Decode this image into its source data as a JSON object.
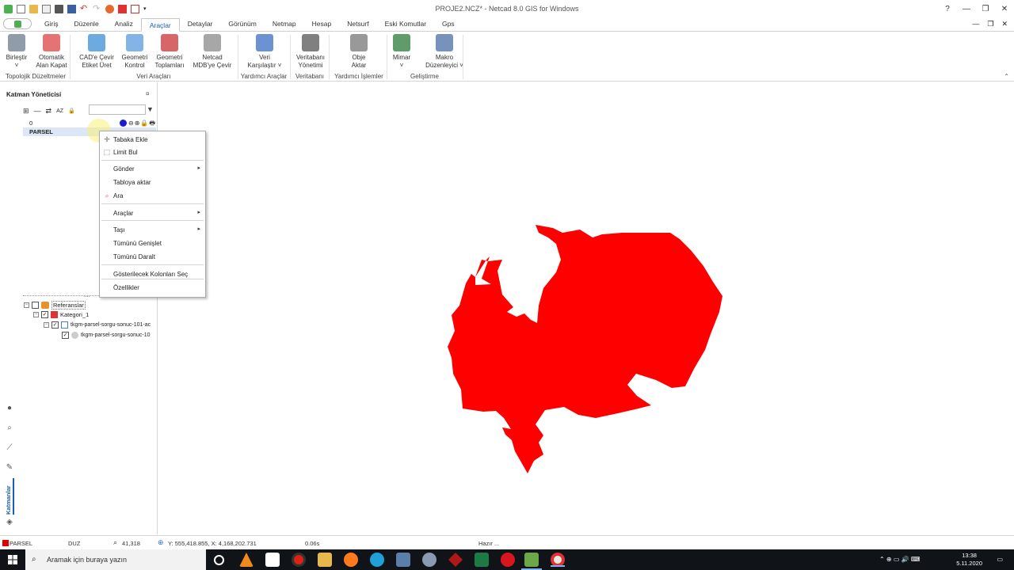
{
  "window": {
    "title": "PROJE2.NCZ* - Netcad 8.0 GIS for Windows",
    "help": "?",
    "minimize": "—",
    "restore": "❐",
    "close": "✕"
  },
  "ribbon_tabs": [
    "Giriş",
    "Düzenle",
    "Analiz",
    "Araçlar",
    "Detaylar",
    "Görünüm",
    "Netmap",
    "Hesap",
    "Netsurf",
    "Eski Komutlar",
    "Gps"
  ],
  "active_tab": "Araçlar",
  "ribbon": {
    "buttons": [
      {
        "label1": "Birleştir",
        "label2": "˅",
        "icon": "merge-icon",
        "color": "#6b7b8c"
      },
      {
        "label1": "Otomatik",
        "label2": "Alan Kapat",
        "icon": "polygon-close-icon",
        "color": "#d44"
      },
      {
        "label1": "CAD'e Çevir",
        "label2": "Etiket Üret",
        "icon": "cad-convert-icon",
        "color": "#3a8fd6"
      },
      {
        "label1": "Geometri",
        "label2": "Kontrol",
        "icon": "geometry-check-icon",
        "color": "#5a9be0"
      },
      {
        "label1": "Geometri",
        "label2": "Toplamları",
        "icon": "geometry-sum-icon",
        "color": "#c33"
      },
      {
        "label1": "Netcad",
        "label2": "MDB'ye Çevir",
        "icon": "gear-icon",
        "color": "#8a8a8a"
      },
      {
        "label1": "Veri",
        "label2": "Karşılaştır ˅",
        "icon": "compare-icon",
        "color": "#3a6fc4"
      },
      {
        "label1": "Veritabanı",
        "label2": "Yönetimi",
        "icon": "database-icon",
        "color": "#555"
      },
      {
        "label1": "Obje",
        "label2": "Aktar",
        "icon": "object-transfer-icon",
        "color": "#777"
      },
      {
        "label1": "Mimar",
        "label2": "˅",
        "icon": "architect-icon",
        "color": "#2a7a3a"
      },
      {
        "label1": "Makro",
        "label2": "Düzenleyici ˅",
        "icon": "macro-editor-icon",
        "color": "#4a6fa5"
      }
    ],
    "groups": [
      "Topolojik Düzeltmeler",
      "Veri Araçları",
      "Yardımcı Araçlar",
      "Veritabanı",
      "Yardımcı İşlemler",
      "Geliştirme"
    ]
  },
  "layer_panel": {
    "title": "Katman Yöneticisi",
    "pin": "¤",
    "toolbar": [
      "⊞",
      "—",
      "⇄",
      "AZ",
      "🔒"
    ],
    "filter_icon": "▼",
    "layers": [
      {
        "name": "0",
        "selected": false
      },
      {
        "name": "PARSEL",
        "selected": true
      }
    ],
    "layer_icons": "⊖⊕🔒🖶",
    "splitter": "....",
    "references": {
      "root": "Referanslar",
      "category": "Kategori_1",
      "item": "tkgm-parsel-sorgu-sonuc-101-ac",
      "sub": "tkgm-parsel-sorgu-sonuc-10"
    },
    "side_tab": "Katmanlar"
  },
  "context_menu": {
    "items": [
      {
        "label": "Tabaka Ekle",
        "icon": "add-layer-icon",
        "arrow": false
      },
      {
        "label": "Limit Bul",
        "icon": "limit-icon",
        "arrow": false
      },
      {
        "label": "Gönder",
        "icon": "",
        "arrow": true
      },
      {
        "label": "Tabloya aktar",
        "icon": "",
        "arrow": false
      },
      {
        "label": "Ara",
        "icon": "search-icon",
        "arrow": false
      },
      {
        "label": "Araçlar",
        "icon": "",
        "arrow": true
      },
      {
        "label": "Taşı",
        "icon": "",
        "arrow": true
      },
      {
        "label": "Tümünü Genişlet",
        "icon": "",
        "arrow": false
      },
      {
        "label": "Tümünü Daralt",
        "icon": "",
        "arrow": false
      },
      {
        "label": "Gösterilecek Kolonları Seç",
        "icon": "",
        "arrow": false
      },
      {
        "label": "Özellikler",
        "icon": "",
        "arrow": false
      }
    ]
  },
  "canvas": {
    "parcel_color": "#ff0000"
  },
  "status": {
    "layer": "PARSEL",
    "layer_color": "#e00000",
    "mode": "DUZ",
    "zoom": "41,318",
    "coords": "Y: 555,418.855, X: 4,168,202.731",
    "time": "0.06s",
    "state": "Hazır ..."
  },
  "taskbar": {
    "search_placeholder": "Aramak için buraya yazın",
    "time": "13:38",
    "date": "5.11.2020",
    "tray": "⌃  ⊕  ▭  🔊  ⌨"
  }
}
